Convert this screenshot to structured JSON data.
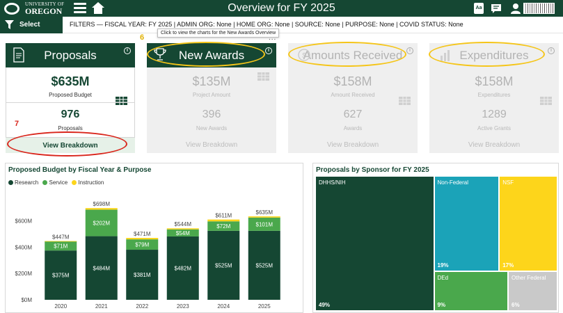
{
  "header": {
    "logo_line1": "UNIVERSITY OF",
    "logo_line2": "OREGON",
    "title": "Overview for FY 2025",
    "icons": [
      "hamburger-menu-icon",
      "home-icon",
      "accessibility-icon",
      "chat-icon",
      "user-icon"
    ],
    "accessibility_label": "Aa"
  },
  "filters": {
    "button_label": "Select Filters",
    "text": "FILTERS — FISCAL YEAR: FY 2025 | ADMIN ORG: None | HOME ORG: None | SOURCE: None | PURPOSE: None | COVID STATUS: None"
  },
  "tooltip": "Click to view the charts for the New Awards Overview",
  "more_options": "...",
  "annotations": {
    "six": "6",
    "seven": "7"
  },
  "kpis": [
    {
      "title": "Proposals",
      "value": "$635M",
      "value_label": "Proposed Budget",
      "count": "976",
      "count_label": "Proposals",
      "button": "View Breakdown"
    },
    {
      "title": "New Awards",
      "value": "$135M",
      "value_label": "Project Amount",
      "count": "396",
      "count_label": "New Awards",
      "button": "View Breakdown"
    },
    {
      "title": "Amounts Received",
      "value": "$158M",
      "value_label": "Amount Received",
      "count": "627",
      "count_label": "Awards",
      "button": "View Breakdown"
    },
    {
      "title": "Expenditures",
      "value": "$158M",
      "value_label": "Expenditures",
      "count": "1289",
      "count_label": "Active Grants",
      "button": "View Breakdown"
    }
  ],
  "colors": {
    "brand_green": "#154733",
    "service_green": "#4aa84c",
    "instruction_yellow": "#fdd51b",
    "annotation_yellow": "#f5c518",
    "annotation_red": "#d9261c"
  },
  "chart_data": [
    {
      "type": "bar",
      "title": "Proposed Budget by Fiscal Year & Purpose",
      "categories": [
        "2020",
        "2021",
        "2022",
        "2023",
        "2024",
        "2025"
      ],
      "series": [
        {
          "name": "Research",
          "color": "#154733",
          "values": [
            375,
            484,
            381,
            482,
            525,
            525
          ],
          "labels": [
            "$375M",
            "$484M",
            "$381M",
            "$482M",
            "$525M",
            "$525M"
          ]
        },
        {
          "name": "Service",
          "color": "#4aa84c",
          "values": [
            71,
            202,
            79,
            54,
            72,
            101
          ],
          "labels": [
            "$71M",
            "$202M",
            "$79M",
            "$54M",
            "$72M",
            "$101M"
          ]
        },
        {
          "name": "Instruction",
          "color": "#fdd51b",
          "values": [
            1,
            12,
            11,
            8,
            14,
            9
          ],
          "labels": [
            "",
            "",
            "",
            "",
            "",
            ""
          ]
        }
      ],
      "totals": [
        "$447M",
        "$698M",
        "$471M",
        "$544M",
        "$611M",
        "$635M"
      ],
      "ylim": [
        0,
        720
      ],
      "yticks": [
        0,
        200,
        400,
        600
      ],
      "ytick_labels": [
        "$0M",
        "$200M",
        "$400M",
        "$600M"
      ],
      "legend_position": "top-left",
      "grid": false
    },
    {
      "type": "treemap",
      "title": "Proposals by Sponsor for FY 2025",
      "items": [
        {
          "name": "DHHS/NIH",
          "value": 49,
          "label": "49%",
          "color": "#154733"
        },
        {
          "name": "Non-Federal",
          "value": 19,
          "label": "19%",
          "color": "#1ba3b8"
        },
        {
          "name": "NSF",
          "value": 17,
          "label": "17%",
          "color": "#fdd51b"
        },
        {
          "name": "DEd",
          "value": 9,
          "label": "9%",
          "color": "#4aa84c"
        },
        {
          "name": "Other Federal",
          "value": 6,
          "label": "6%",
          "color": "#c9c9c9"
        }
      ]
    }
  ]
}
